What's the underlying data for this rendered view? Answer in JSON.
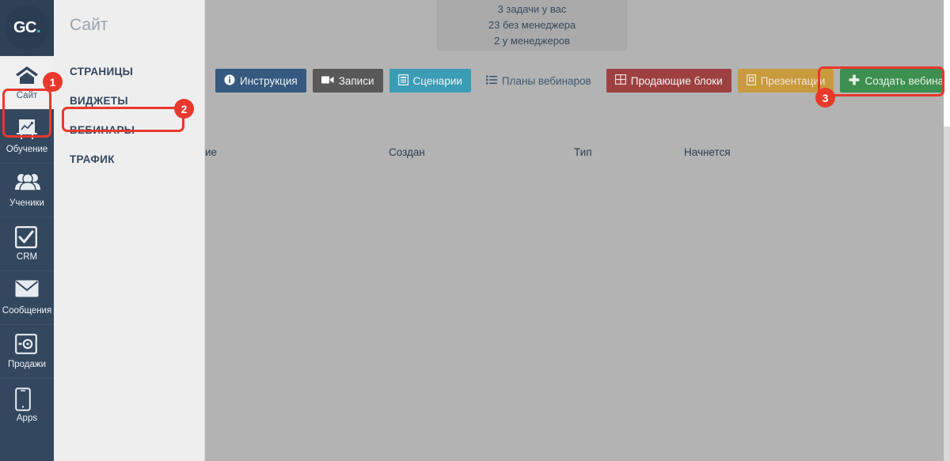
{
  "brand": {
    "logo_g": "GC",
    "logo_c": ".",
    "logo_full": "GC."
  },
  "colors": {
    "rail_bg": "#33475e",
    "accent_teal": "#2ec7c0",
    "highlight_red": "#e8392c",
    "overlay_gray": "#b3b3b3",
    "subnav_bg": "#eeeeee"
  },
  "rail": {
    "items": [
      {
        "label": "Сайт",
        "icon": "home-icon",
        "active": true
      },
      {
        "label": "Обучение",
        "icon": "easel-chart-icon",
        "active": false
      },
      {
        "label": "Ученики",
        "icon": "users-icon",
        "active": false
      },
      {
        "label": "CRM",
        "icon": "checkbox-icon",
        "active": false
      },
      {
        "label": "Сообщения",
        "icon": "envelope-icon",
        "active": false
      },
      {
        "label": "Продажи",
        "icon": "safe-icon",
        "active": false
      },
      {
        "label": "Apps",
        "icon": "mobile-icon",
        "active": false
      }
    ]
  },
  "subnav": {
    "title": "Сайт",
    "items": [
      {
        "label": "СТРАНИЦЫ"
      },
      {
        "label": "ВИДЖЕТЫ"
      },
      {
        "label": "ВЕБИНАРЫ"
      },
      {
        "label": "ТРАФИК"
      }
    ]
  },
  "tasks": {
    "line1": "3 задачи у вас",
    "line2": "23 без менеджера",
    "line3": "2 у менеджеров"
  },
  "toolbar": {
    "buttons": [
      {
        "label": "Инструкция",
        "icon": "info-circle-icon"
      },
      {
        "label": "Записи",
        "icon": "video-camera-icon"
      },
      {
        "label": "Сценарии",
        "icon": "script-file-icon"
      },
      {
        "label": "Планы вебинаров",
        "icon": "list-icon"
      },
      {
        "label": "Продающие блоки",
        "icon": "grid-blocks-icon"
      },
      {
        "label": "Презентации",
        "icon": "presentation-file-icon"
      },
      {
        "label": "Создать вебинар",
        "icon": "plus-icon"
      }
    ]
  },
  "table": {
    "headers": [
      "ие",
      "Создан",
      "Тип",
      "Начнется"
    ],
    "rows": []
  },
  "annotations": {
    "step1": "1",
    "step2": "2",
    "step3": "3"
  }
}
